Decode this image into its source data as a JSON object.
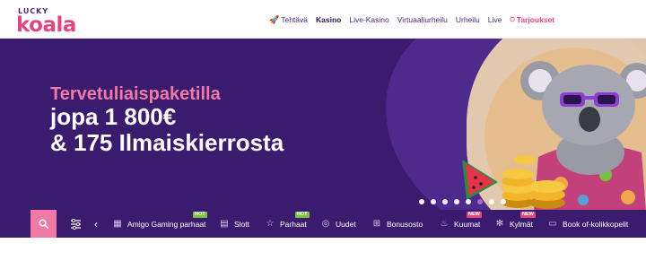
{
  "brand": {
    "small": "LUCKY",
    "main": "koala"
  },
  "nav": {
    "items": [
      {
        "label": "Tehtävä",
        "icon": "rocket-icon"
      },
      {
        "label": "Kasino",
        "active": true
      },
      {
        "label": "Live-Kasino"
      },
      {
        "label": "Virtuaaliurheilu"
      },
      {
        "label": "Urheilu"
      },
      {
        "label": "Live"
      },
      {
        "label": "Tarjoukset",
        "icon": "gift-icon"
      }
    ]
  },
  "hero": {
    "line1": "Tervetuliaispaketilla",
    "line2": "jopa 1 800€",
    "line3": "& 175 Ilmaiskierrosta",
    "slides": 8,
    "active_slide": 5
  },
  "categories": {
    "items": [
      {
        "label": "Amigo Gaming parhaat",
        "icon": "grid-icon",
        "badge": "HOT"
      },
      {
        "label": "Slott",
        "icon": "slot-icon"
      },
      {
        "label": "Parhaat",
        "icon": "star-icon",
        "badge": "HOT"
      },
      {
        "label": "Uudet",
        "icon": "new-icon"
      },
      {
        "label": "Bonusosto",
        "icon": "gift-icon"
      },
      {
        "label": "Kuumat",
        "icon": "flame-icon",
        "badge": "NEW"
      },
      {
        "label": "Kylmät",
        "icon": "snowflake-icon",
        "badge": "NEW"
      },
      {
        "label": "Book of-kolikkopelit",
        "icon": "book-icon"
      }
    ]
  },
  "colors": {
    "brand_pink": "#e1467e",
    "brand_purple": "#3a1b6e",
    "hot_badge": "#7bc043"
  }
}
